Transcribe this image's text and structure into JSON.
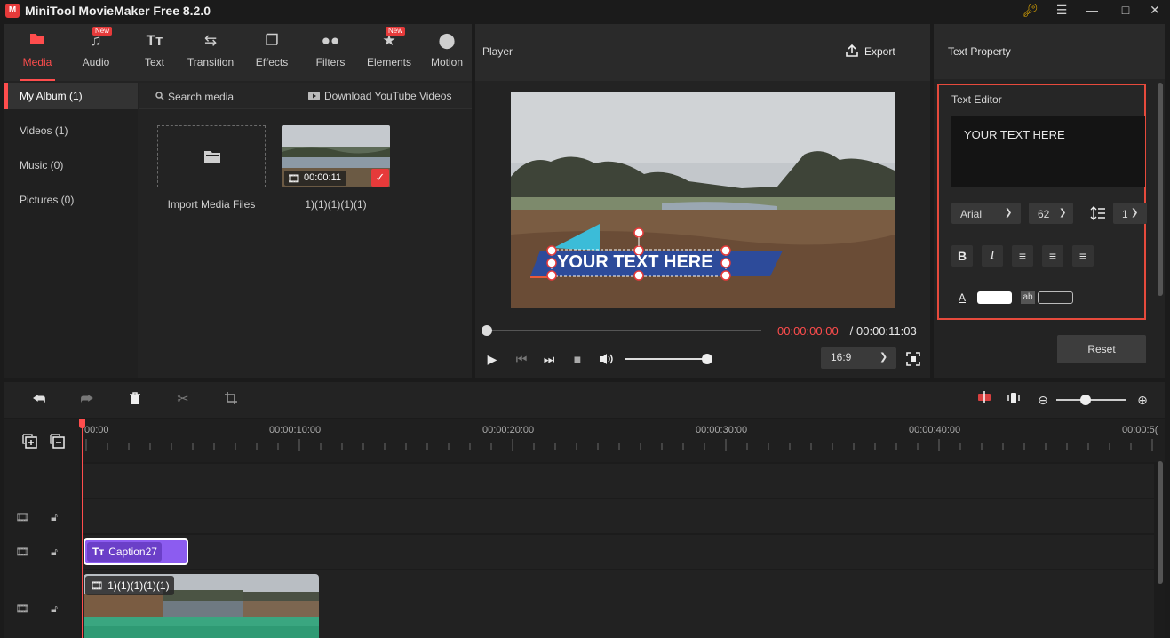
{
  "window": {
    "title": "MiniTool MovieMaker Free 8.2.0",
    "logo": "M",
    "icons": [
      "key-icon",
      "menu-icon",
      "minimize-icon",
      "maximize-icon",
      "close-icon"
    ]
  },
  "toolbar": {
    "tabs": [
      {
        "label": "Media",
        "icon": "folder-icon",
        "active": true
      },
      {
        "label": "Audio",
        "icon": "music-icon",
        "badge": "New"
      },
      {
        "label": "Text",
        "icon": "text-icon"
      },
      {
        "label": "Transition",
        "icon": "transition-icon"
      },
      {
        "label": "Effects",
        "icon": "effects-icon"
      },
      {
        "label": "Filters",
        "icon": "filters-icon"
      },
      {
        "label": "Elements",
        "icon": "elements-icon",
        "badge": "New"
      },
      {
        "label": "Motion",
        "icon": "motion-icon"
      }
    ]
  },
  "media": {
    "sidebar": [
      "My Album (1)",
      "Videos (1)",
      "Music (0)",
      "Pictures (0)"
    ],
    "search_placeholder": "Search media",
    "youtube_label": "Download YouTube Videos",
    "import_label": "Import Media Files",
    "clip_duration": "00:00:11",
    "clip_name": "1)(1)(1)(1)(1)"
  },
  "player": {
    "title": "Player",
    "export_label": "Export",
    "overlay_text": "YOUR TEXT HERE",
    "time_current": "00:00:00:00",
    "time_separator": " / ",
    "time_total": "00:00:11:03",
    "aspect_ratio": "16:9",
    "progress": 0.0,
    "volume": 0.95
  },
  "text_property": {
    "title": "Text Property",
    "editor_title": "Text Editor",
    "text_value": "YOUR TEXT HERE",
    "font": "Arial",
    "size": "62",
    "line_spacing": "1",
    "text_color": "#ffffff",
    "reset_label": "Reset"
  },
  "timeline": {
    "ruler_labels": [
      "00:00",
      "00:00:10:00",
      "00:00:20:00",
      "00:00:30:00",
      "00:00:40:00",
      "00:00:5("
    ],
    "caption_clip": "Caption27",
    "video_clip": "1)(1)(1)(1)(1)"
  },
  "colors": {
    "accent": "#ff4d4d",
    "caption_clip": "#8c5cf0",
    "video_audio_strip": "#2f9a74",
    "banner": "#2d4b9a",
    "banner_accent": "#3bbcd8",
    "selection_border": "#e64a3c"
  }
}
